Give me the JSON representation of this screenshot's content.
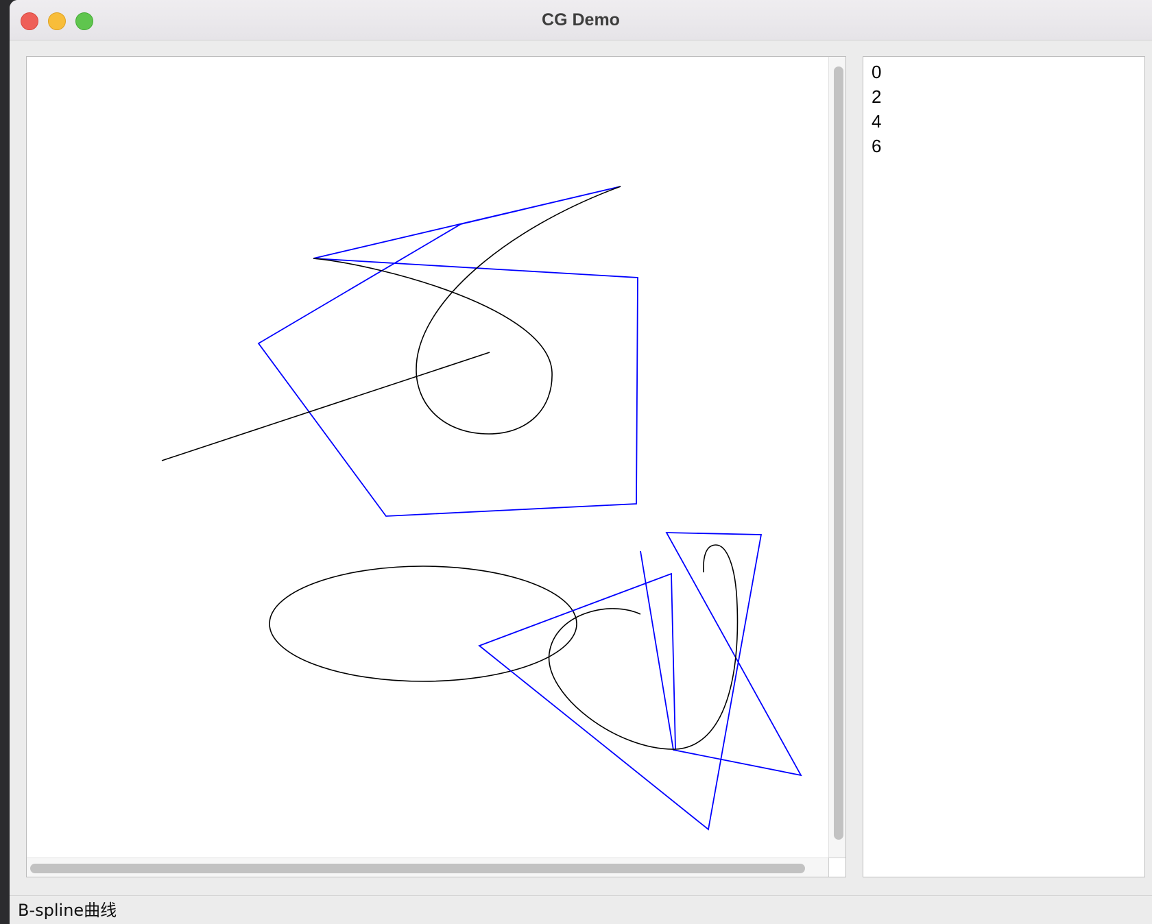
{
  "window": {
    "title": "CG Demo"
  },
  "drawing_list": {
    "items": [
      "0",
      "2",
      "4",
      "6"
    ]
  },
  "status_bar": {
    "text": "B-spline曲线"
  },
  "colors": {
    "control_polygon": "#0000ff",
    "curve": "#000000",
    "canvas_background": "#ffffff"
  }
}
